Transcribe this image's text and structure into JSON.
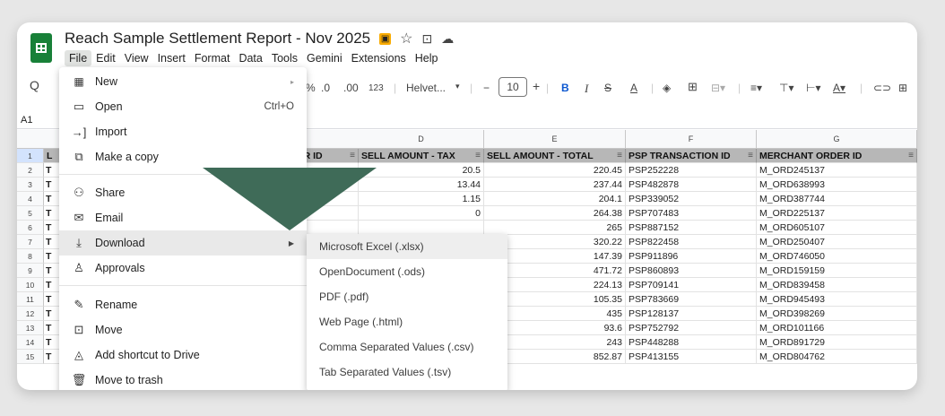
{
  "window": {
    "title": "Reach Sample Settlement Report - Nov 2025",
    "title_icons": [
      "folder-badge-icon",
      "star-icon",
      "move-folder-icon",
      "cloud-status-icon"
    ]
  },
  "menubar": [
    "File",
    "Edit",
    "View",
    "Insert",
    "Format",
    "Data",
    "Tools",
    "Gemini",
    "Extensions",
    "Help"
  ],
  "toolbar": {
    "percent": "%",
    "dec_decrease": ".0",
    "dec_increase": ".00",
    "number_format": "123",
    "font": "Helvet...",
    "minus": "−",
    "font_size": "10",
    "plus": "+",
    "bold": "B",
    "italic": "I",
    "strike": "S",
    "text_color": "A"
  },
  "namebox": "A1",
  "columns": [
    "D",
    "E",
    "F",
    "G"
  ],
  "row_numbers": [
    "1",
    "2",
    "3",
    "4",
    "5",
    "6",
    "7",
    "8",
    "9",
    "10",
    "11",
    "12",
    "13",
    "14",
    "15"
  ],
  "headers": {
    "col_a": "L",
    "order_id": "DER ID",
    "tax": "SELL AMOUNT - TAX",
    "total": "SELL AMOUNT - TOTAL",
    "psp": "PSP TRANSACTION ID",
    "merchant": "MERCHANT ORDER ID"
  },
  "rows": [
    {
      "a": "T",
      "tax": "20.5",
      "total": "220.45",
      "psp": "PSP252228",
      "merchant": "M_ORD245137"
    },
    {
      "a": "T",
      "tax": "13.44",
      "total": "237.44",
      "psp": "PSP482878",
      "merchant": "M_ORD638993"
    },
    {
      "a": "T",
      "tax": "1.15",
      "total": "204.1",
      "psp": "PSP339052",
      "merchant": "M_ORD387744"
    },
    {
      "a": "T",
      "tax": "0",
      "total": "264.38",
      "psp": "PSP707483",
      "merchant": "M_ORD225137"
    },
    {
      "a": "T",
      "tax": "",
      "total": "265",
      "psp": "PSP887152",
      "merchant": "M_ORD605107"
    },
    {
      "a": "T",
      "tax": "",
      "total": "320.22",
      "psp": "PSP822458",
      "merchant": "M_ORD250407"
    },
    {
      "a": "T",
      "tax": "",
      "total": "147.39",
      "psp": "PSP911896",
      "merchant": "M_ORD746050"
    },
    {
      "a": "T",
      "tax": "",
      "total": "471.72",
      "psp": "PSP860893",
      "merchant": "M_ORD159159"
    },
    {
      "a": "T",
      "tax": "",
      "total": "224.13",
      "psp": "PSP709141",
      "merchant": "M_ORD839458"
    },
    {
      "a": "T",
      "tax": "",
      "total": "105.35",
      "psp": "PSP783669",
      "merchant": "M_ORD945493"
    },
    {
      "a": "T",
      "tax": "",
      "total": "435",
      "psp": "PSP128137",
      "merchant": "M_ORD398269"
    },
    {
      "a": "T",
      "tax": "",
      "total": "93.6",
      "psp": "PSP752792",
      "merchant": "M_ORD101166"
    },
    {
      "a": "T",
      "tax": "",
      "total": "243",
      "psp": "PSP448288",
      "merchant": "M_ORD891729"
    },
    {
      "a": "T",
      "tax": "",
      "total": "852.87",
      "psp": "PSP413155",
      "merchant": "M_ORD804762"
    }
  ],
  "file_menu": {
    "new": "New",
    "open": "Open",
    "open_shortcut": "Ctrl+O",
    "import": "Import",
    "make_copy": "Make a copy",
    "share": "Share",
    "email": "Email",
    "download": "Download",
    "approvals": "Approvals",
    "rename": "Rename",
    "move": "Move",
    "add_shortcut": "Add shortcut to Drive",
    "trash": "Move to trash"
  },
  "download_menu": [
    "Microsoft Excel (.xlsx)",
    "OpenDocument (.ods)",
    "PDF (.pdf)",
    "Web Page (.html)",
    "Comma Separated Values (.csv)",
    "Tab Separated Values (.tsv)"
  ],
  "colors": {
    "sheets_green": "#188038",
    "header_fill": "#b7b7b7",
    "pointer_green": "#3f6b58"
  }
}
